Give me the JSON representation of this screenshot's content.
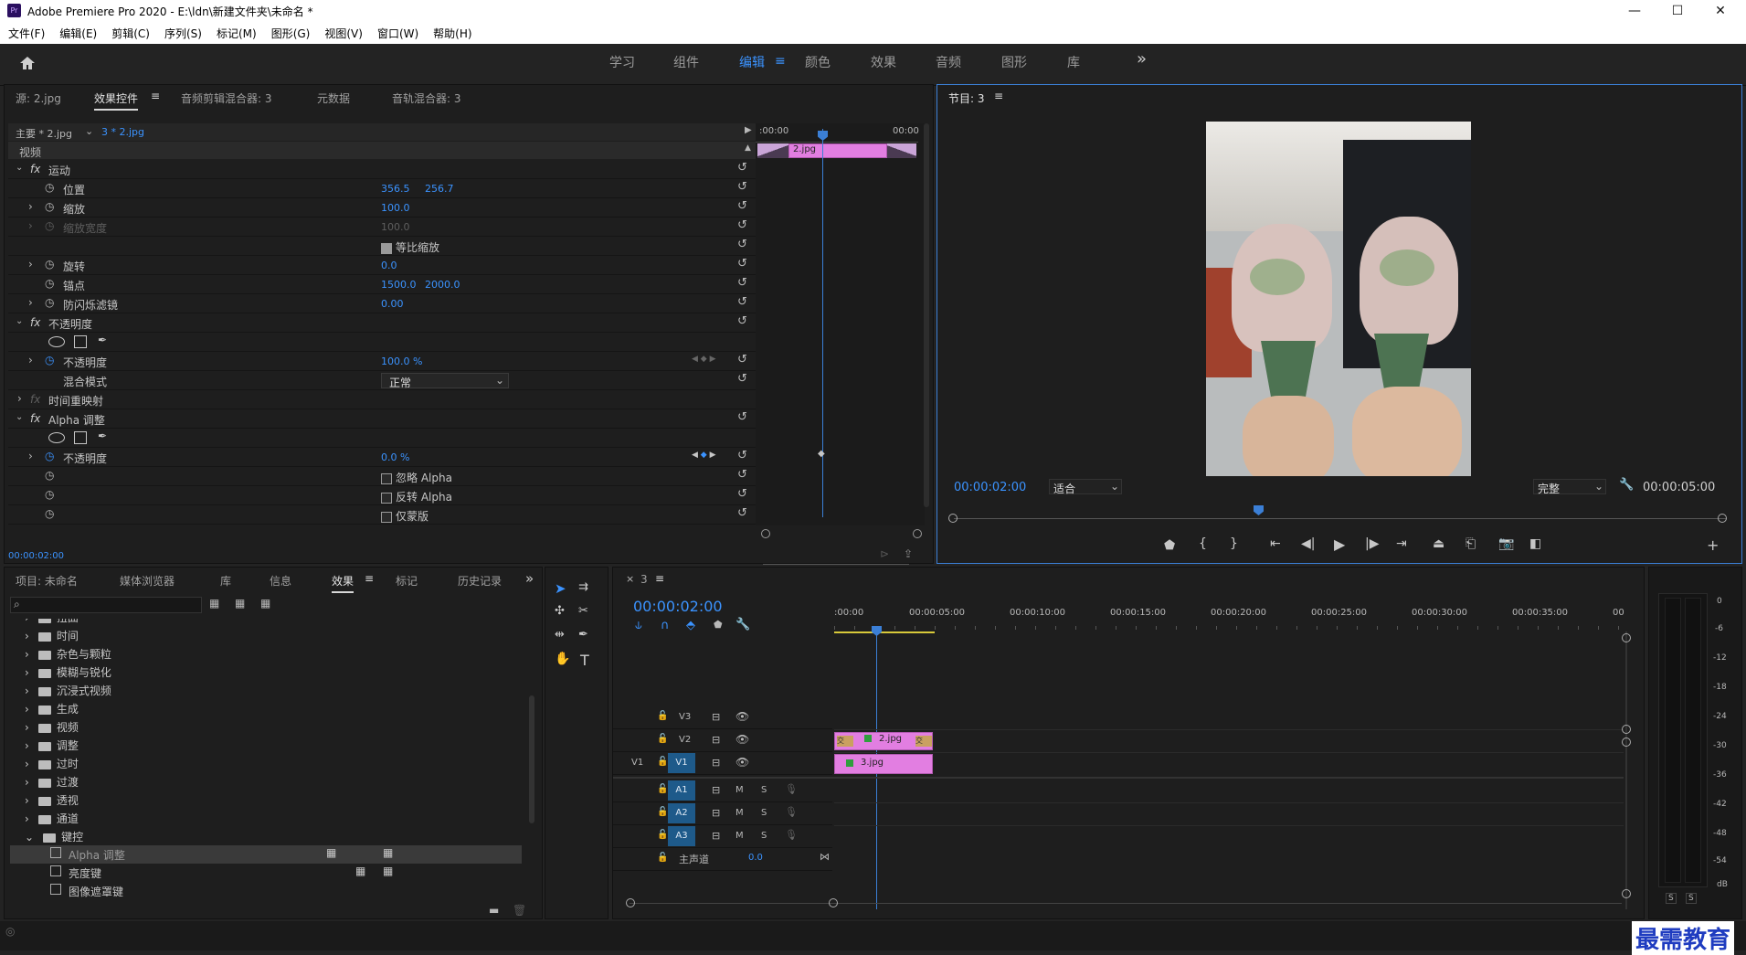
{
  "window": {
    "app_icon": "Pr",
    "title": "Adobe Premiere Pro 2020 - E:\\ldn\\新建文件夹\\未命名 *",
    "min": "—",
    "max": "☐",
    "close": "✕"
  },
  "menu": [
    "文件(F)",
    "编辑(E)",
    "剪辑(C)",
    "序列(S)",
    "标记(M)",
    "图形(G)",
    "视图(V)",
    "窗口(W)",
    "帮助(H)"
  ],
  "workspaces": [
    "学习",
    "组件",
    "编辑",
    "颜色",
    "效果",
    "音频",
    "图形",
    "库"
  ],
  "workspace_active": "编辑",
  "more": "»",
  "source_panel": {
    "tabs": [
      "源: 2.jpg",
      "效果控件",
      "音频剪辑混合器: 3",
      "元数据",
      "音轨混合器: 3"
    ],
    "active_tab": "效果控件",
    "master": "主要 * 2.jpg",
    "clip": "3 * 2.jpg",
    "video": "视频",
    "tc_start": ":00:00",
    "tc_end": "00:00",
    "clip_label": "2.jpg",
    "timecode": "00:00:02:00",
    "motion": "运动",
    "position": "位置",
    "pos_x": "356.5",
    "pos_y": "256.7",
    "scale": "缩放",
    "scale_v": "100.0",
    "scale_w": "缩放宽度",
    "scale_w_v": "100.0",
    "uniform": "等比缩放",
    "rotation": "旋转",
    "rotation_v": "0.0",
    "anchor": "锚点",
    "anchor_x": "1500.0",
    "anchor_y": "2000.0",
    "flicker": "防闪烁滤镜",
    "flicker_v": "0.00",
    "opacity_group": "不透明度",
    "opacity": "不透明度",
    "opacity_v": "100.0 %",
    "blend": "混合模式",
    "blend_v": "正常",
    "timeremap": "时间重映射",
    "alpha_group": "Alpha 调整",
    "alpha_opacity": "不透明度",
    "alpha_opacity_v": "0.0 %",
    "ignore_alpha": "忽略 Alpha",
    "invert_alpha": "反转 Alpha",
    "mask_only": "仅蒙版",
    "fx": "fx"
  },
  "program": {
    "title": "节目: 3",
    "timecode": "00:00:02:00",
    "fit": "适合",
    "quality": "完整",
    "duration": "00:00:05:00"
  },
  "project_panel": {
    "tabs": [
      "项目: 未命名",
      "媒体浏览器",
      "库",
      "信息",
      "效果",
      "标记",
      "历史记录"
    ],
    "active_tab": "效果",
    "folders": [
      "扭曲",
      "时间",
      "杂色与颗粒",
      "模糊与锐化",
      "沉浸式视频",
      "生成",
      "视频",
      "调整",
      "过时",
      "过渡",
      "透视",
      "通道",
      "键控"
    ],
    "items": [
      "Alpha 调整",
      "亮度键",
      "图像遮罩键"
    ]
  },
  "timeline": {
    "seq": "3",
    "timecode": "00:00:02:00",
    "ruler": [
      ":00:00",
      "00:00:05:00",
      "00:00:10:00",
      "00:00:15:00",
      "00:00:20:00",
      "00:00:25:00",
      "00:00:30:00",
      "00:00:35:00",
      "00"
    ],
    "tracks_v": [
      "V3",
      "V2",
      "V1"
    ],
    "tracks_a": [
      "A1",
      "A2",
      "A3"
    ],
    "src_v": "V1",
    "master": "主声道",
    "master_v": "0.0",
    "clip_v2": "2.jpg",
    "clip_v1": "3.jpg",
    "m": "M",
    "s": "S"
  },
  "meter": {
    "scale": [
      "0",
      "-6",
      "-12",
      "-18",
      "-24",
      "-30",
      "-36",
      "-42",
      "-48",
      "-54",
      "dB"
    ],
    "solo": [
      "S",
      "S"
    ]
  },
  "watermark": "最需教育"
}
